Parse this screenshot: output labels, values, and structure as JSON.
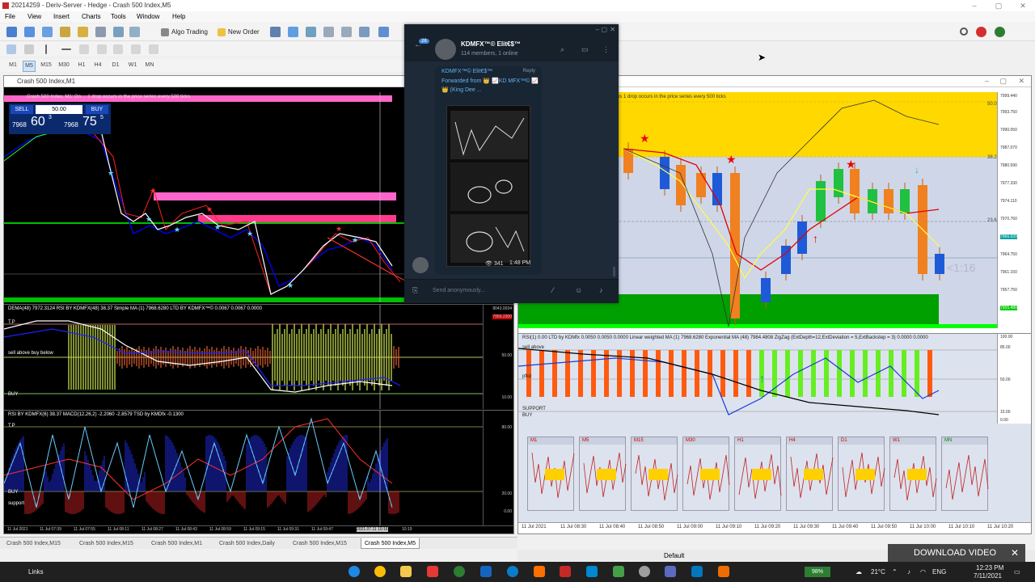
{
  "window": {
    "title": "20214259 - Deriv-Server - Hedge - Crash 500 Index,M5",
    "minimize": "–",
    "maximize": "▢",
    "close": "✕"
  },
  "menu": [
    "File",
    "View",
    "Insert",
    "Charts",
    "Tools",
    "Window",
    "Help"
  ],
  "toolbar": {
    "algo_trading": "Algo Trading",
    "new_order": "New Order"
  },
  "timeframes": [
    "M1",
    "M5",
    "M15",
    "M30",
    "H1",
    "H4",
    "D1",
    "W1",
    "MN"
  ],
  "active_timeframe": "M5",
  "left_window": {
    "title": "Crash 500 Index,M1",
    "chart_label": "Crash 500 Index, M1: On ... 1 drop occurs in the price series every 500 ticks",
    "sell": "SELL",
    "buy": "BUY",
    "lot": "50.00",
    "bid_prefix": "7968",
    "bid_big": "60",
    "bid_sup": "3",
    "ask_prefix": "7968",
    "ask_big": "75",
    "ask_sup": "5",
    "ind1_label": "DEMA(48) 7972.3124 RSI BY KDMFX(48) 38.37 Simple MA (1) 7968.6280 LTD BY KDMFX™© 0.0067 0.0067 0.0000",
    "ind1_top": "T.P",
    "ind1_mid": "sell above buy below",
    "ind1_buy": "BUY",
    "ind1_axis": [
      "8043.0034",
      "7956.2300",
      "50.00",
      "10.00"
    ],
    "ind2_label": "RSI BY KDMFX(6) 38.37 MACD(12,26,2) -2.2060 -2.8579 TSD by KMDfx -0.1300",
    "ind2_top": "T.P",
    "ind2_buy": "BUY",
    "ind2_support": "support",
    "ind2_axis": [
      "80.00",
      "20.00",
      "0.00"
    ],
    "time_labels": [
      "11 Jul 2021",
      "11 Jul 07:39",
      "11 Jul 07:55",
      "11 Jul 08:11",
      "11 Jul 08:27",
      "11 Jul 08:43",
      "11 Jul 08:59",
      "11 Jul 09:15",
      "11 Jul 09:31",
      "11 Jul 09:47",
      "2021.07.11 10:16",
      "10:19"
    ]
  },
  "telegram": {
    "channel": "KDMFX™© Elit€$™",
    "members": "114 members, 1 online",
    "unread": "28",
    "sender": "KDMFX™© Elit€$™",
    "reply": "Reply",
    "forwarded": "Forwarded from 👑 📈KD MFX™© 📈👑 (King Dee ...",
    "views": "341",
    "time": "1:48 PM",
    "placeholder": "Send anonymously..."
  },
  "right_window": {
    "chart_label": "ps 1 drop occurs in the price series every 500 ticks",
    "axis": [
      "7999.440",
      "7993.750",
      "7990.050",
      "7987.070",
      "7980.590",
      "7977.330",
      "7974.110",
      "7970.760",
      "7966.620",
      "7964.750",
      "7961.150",
      "7957.750",
      "7955.480"
    ],
    "level_labels": [
      "50.0",
      "38.2",
      "23.6"
    ],
    "countdown": "<1:16",
    "ind_label": "RSI(1) 0.00 LTD by KDMfx 0.0050 0.0050 0.0000 Linear weighted MA (1) 7968.6280 Exponential MA (48) 7984.4808 ZigZag (ExtDepth=12,ExtDeviation = 5,ExtBackstep = 3) 0.0000 0.0000",
    "ind_side": [
      "sell above",
      "pfkd",
      "SUPPORT",
      "BUY"
    ],
    "ind_axis": [
      "100.00",
      "85.00",
      "50.00",
      "15.00",
      "0.00"
    ],
    "mini_charts": [
      "M1",
      "M5",
      "M15",
      "M30",
      "H1",
      "H4",
      "D1",
      "W1",
      "MN"
    ],
    "time_labels": [
      "11 Jul 2021",
      "11 Jul 08:30",
      "11 Jul 08:40",
      "11 Jul 08:50",
      "11 Jul 09:00",
      "11 Jul 09:10",
      "11 Jul 09:20",
      "11 Jul 09:30",
      "11 Jul 09:40",
      "11 Jul 09:50",
      "11 Jul 10:00",
      "11 Jul 10:10",
      "11 Jul 10:20"
    ]
  },
  "tabs": [
    "Crash 500 Index,M15",
    "Crash 500 Index,M15",
    "Crash 500 Index,M1",
    "Crash 500 Index,Daily",
    "Crash 500 Index,M15",
    "Crash 500 Index,M5"
  ],
  "active_tab": 5,
  "status": {
    "profile": "Default"
  },
  "download_video": "DOWNLOAD VIDEO",
  "taskbar": {
    "links": "Links",
    "battery": "98%",
    "temp": "21°C",
    "lang": "ENG",
    "time": "12:23 PM",
    "date": "7/11/2021"
  },
  "colors": {
    "accent": "#1565c0",
    "sell": "#d32f2f",
    "buy": "#1e88e5",
    "bull": "#f08020",
    "bear": "#1e5ad8",
    "zone_yellow": "#ffd800",
    "zone_green": "#00a000",
    "telegram_bg": "#17212b"
  }
}
